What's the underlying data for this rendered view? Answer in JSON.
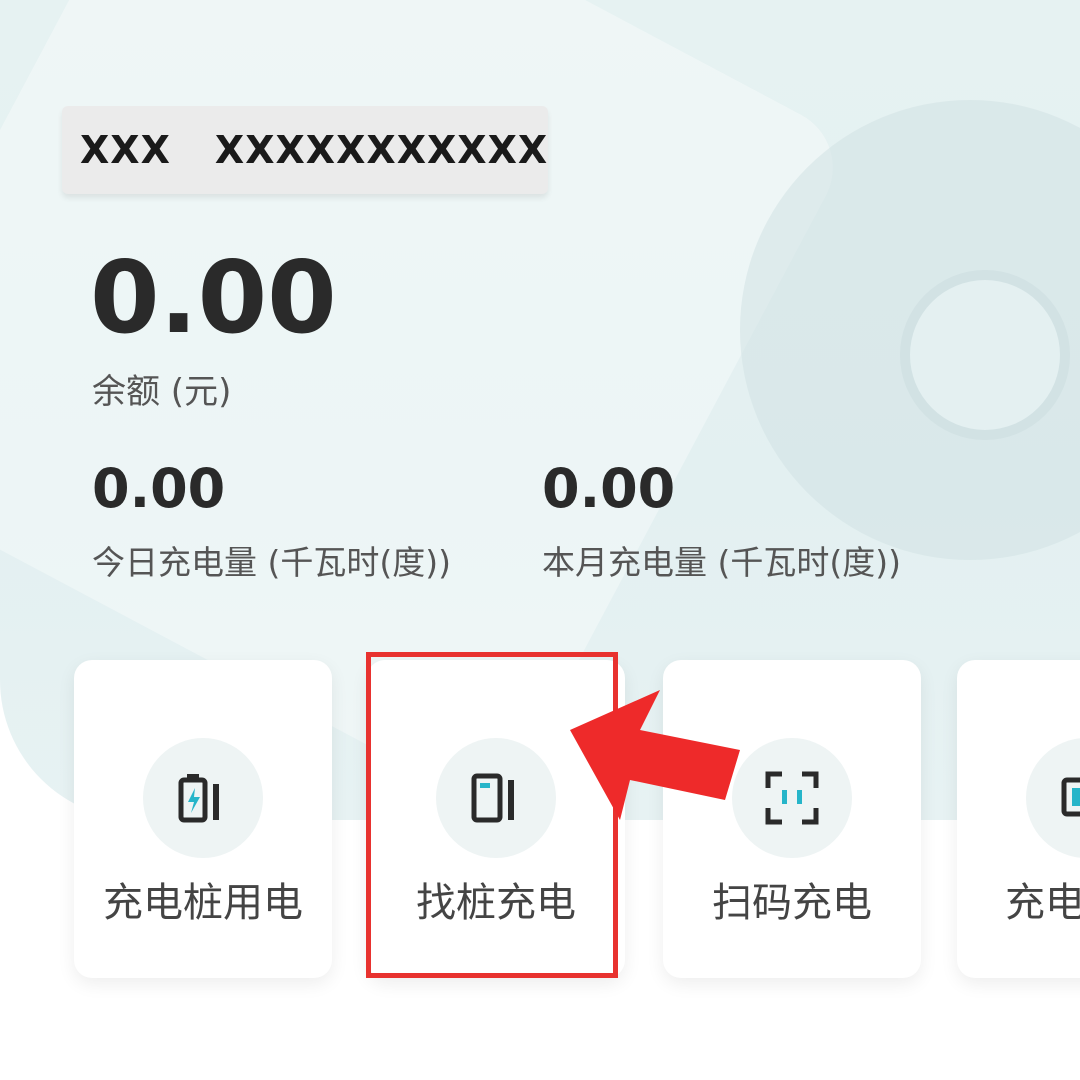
{
  "account": {
    "name": "XXX",
    "number": "XXXXXXXXXXX"
  },
  "balance": {
    "value": "0.00",
    "label": "余额 (元)"
  },
  "stats": {
    "today": {
      "value": "0.00",
      "label": "今日充电量 (千瓦时(度))"
    },
    "month": {
      "value": "0.00",
      "label": "本月充电量 (千瓦时(度))"
    }
  },
  "cards": [
    {
      "label": "充电桩用电",
      "icon": "charging-battery-icon"
    },
    {
      "label": "找桩充电",
      "icon": "charging-pile-icon"
    },
    {
      "label": "扫码充电",
      "icon": "scan-icon"
    },
    {
      "label": "充电",
      "icon": "charger-icon"
    }
  ],
  "colors": {
    "accent": "#26b5c9",
    "highlight": "#e8322f",
    "icon_dark": "#2a2a2a"
  }
}
